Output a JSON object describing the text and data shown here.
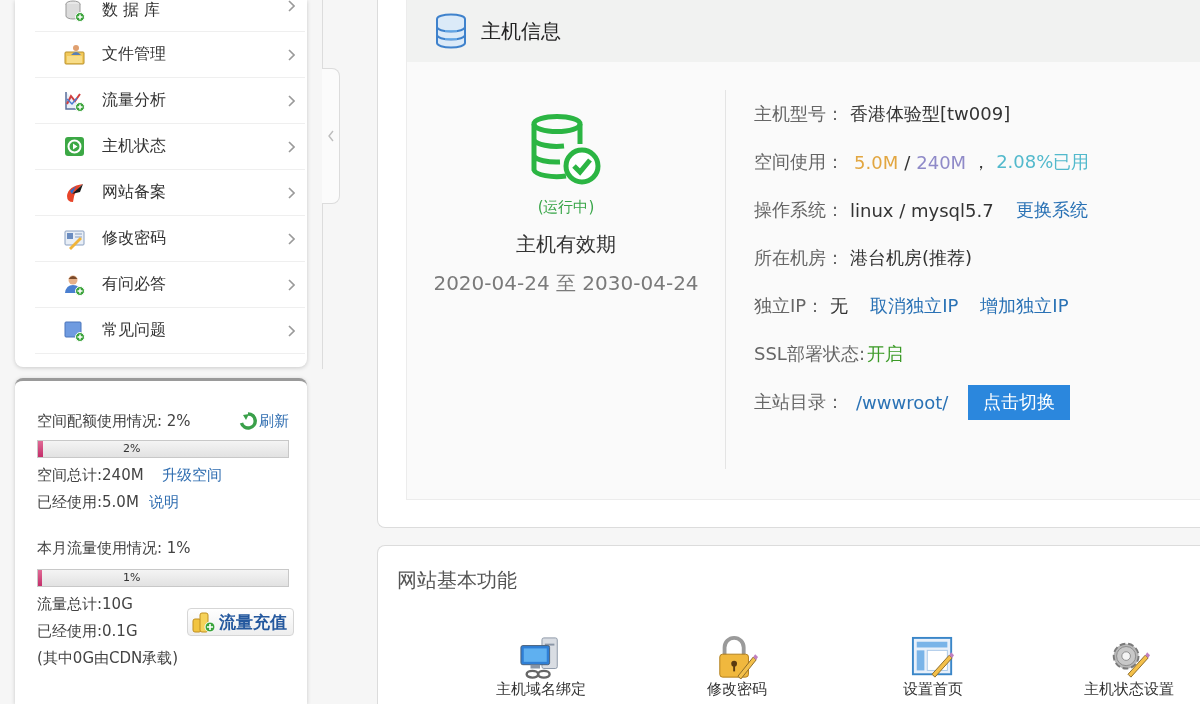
{
  "sidebar": {
    "menu": [
      {
        "label": "数 据 库"
      },
      {
        "label": "文件管理"
      },
      {
        "label": "流量分析"
      },
      {
        "label": "主机状态"
      },
      {
        "label": "网站备案"
      },
      {
        "label": "修改密码"
      },
      {
        "label": "有问必答"
      },
      {
        "label": "常见问题"
      }
    ]
  },
  "usage_panel": {
    "space": {
      "title": "空间配额使用情况: 2%",
      "refresh": "刷新",
      "bar": {
        "level": 0.02,
        "label": "2%"
      },
      "total": "空间总计:240M",
      "upgrade_link": "升级空间",
      "used": "已经使用:5.0M",
      "explain_link": "说明"
    },
    "traffic": {
      "title": "本月流量使用情况: 1%",
      "bar": {
        "level": 0.01,
        "label": "1%"
      },
      "total": "流量总计:10G",
      "used": "已经使用:0.1G",
      "cdn_note": "(其中0G由CDN承载)",
      "recharge_button": "流量充值"
    }
  },
  "host_info": {
    "title": "主机信息",
    "status": "(运行中)",
    "validity_title": "主机有效期",
    "validity_range": "2020-04-24 至 2030-04-24",
    "fields": [
      {
        "label": "主机型号：",
        "items": [
          {
            "kind": "text",
            "text": "香港体验型[tw009]"
          }
        ]
      },
      {
        "label": "空间使用：",
        "items": [
          {
            "kind": "figure",
            "text": "5.0M",
            "color": "#e2a640"
          },
          {
            "kind": "text",
            "text": "/"
          },
          {
            "kind": "figure",
            "text": "240M",
            "color": "#8f8ac8"
          },
          {
            "kind": "text",
            "text": "，"
          },
          {
            "kind": "figure",
            "text": "2.08%已用",
            "color": "#52b9cc"
          }
        ]
      },
      {
        "label": "操作系统：",
        "items": [
          {
            "kind": "text",
            "text": "linux / mysql5.7"
          },
          {
            "kind": "link",
            "text": "更换系统"
          }
        ]
      },
      {
        "label": "所在机房：",
        "items": [
          {
            "kind": "text",
            "text": "港台机房(推荐)"
          }
        ]
      },
      {
        "label": "独立IP：",
        "items": [
          {
            "kind": "text",
            "text": "无"
          },
          {
            "kind": "link",
            "text": "取消独立IP"
          },
          {
            "kind": "link",
            "text": "增加独立IP"
          }
        ]
      },
      {
        "label": "SSL部署状态:",
        "items": [
          {
            "kind": "status",
            "text": "开启",
            "on": true
          }
        ]
      },
      {
        "label": "主站目录：",
        "items": [
          {
            "kind": "link",
            "text": "/wwwroot/"
          },
          {
            "kind": "button",
            "text": "点击切换"
          }
        ]
      }
    ]
  },
  "basic_functions": {
    "title": "网站基本功能",
    "items": [
      {
        "label": "主机域名绑定"
      },
      {
        "label": "修改密码"
      },
      {
        "label": "设置首页"
      },
      {
        "label": "主机状态设置"
      }
    ]
  }
}
